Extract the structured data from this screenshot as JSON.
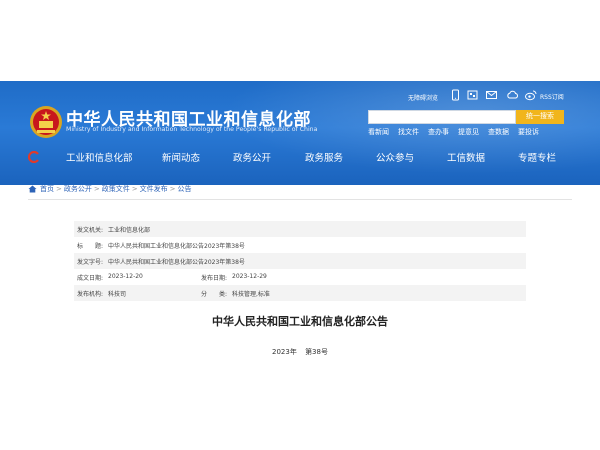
{
  "header": {
    "title": "中华人民共和国工业和信息化部",
    "subtitle": "Ministry of Industry and Information Technology of the People's Republic of China",
    "utility": {
      "accessibility": "无障碍浏览",
      "rss": "RSS订阅",
      "icons": [
        "mobile-icon",
        "mail-icon",
        "cloud-icon",
        "weibo-icon"
      ]
    },
    "search": {
      "placeholder": "",
      "button": "统一搜索"
    },
    "hot_links": [
      "看新闻",
      "找文件",
      "查办事",
      "提意见",
      "查数据",
      "要投诉"
    ]
  },
  "nav": {
    "items": [
      "工业和信息化部",
      "新闻动态",
      "政务公开",
      "政务服务",
      "公众参与",
      "工信数据",
      "专题专栏"
    ]
  },
  "breadcrumb": [
    "首页",
    "政务公开",
    "政策文件",
    "文件发布",
    "公告"
  ],
  "meta": {
    "issuer_label": "发文机关:",
    "issuer": "工业和信息化部",
    "title_label": "标　　题:",
    "title": "中华人民共和国工业和信息化部公告2023年第38号",
    "number_label": "发文字号:",
    "number": "中华人民共和国工业和信息化部公告2023年第38号",
    "created_label": "成文日期:",
    "created": "2023-12-20",
    "published_label": "发布日期:",
    "published": "2023-12-29",
    "publisher_label": "发布机构:",
    "publisher": "科技司",
    "category_label": "分　　类:",
    "category": "科技管理,标准"
  },
  "document": {
    "title": "中华人民共和国工业和信息化部公告",
    "year": "2023年",
    "number": "第38号"
  },
  "colors": {
    "header_blue": "#1f6cc7",
    "search_button": "#f1b51c",
    "link_blue": "#2d63b7"
  }
}
